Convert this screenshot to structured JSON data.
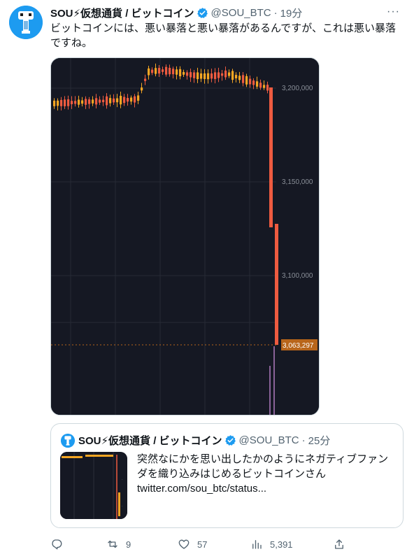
{
  "tweet": {
    "display_name": "SOU⚡仮想通貨 / ビットコイン",
    "handle": "@SOU_BTC",
    "separator": "·",
    "time": "19分",
    "more_label": "···",
    "text_line1": "ビットコインには、悪い暴落と悪い暴落があるんですが、これは悪い暴落",
    "text_line2": "ですね。"
  },
  "chart": {
    "price_labels": [
      "3,200,000",
      "3,150,000",
      "3,100,000"
    ],
    "current_price": "3,063,297",
    "colors": {
      "background": "#151823",
      "up": "#f5a623",
      "down": "#ee5b40",
      "label_bg": "#b8651a"
    }
  },
  "quote": {
    "display_name": "SOU⚡仮想通貨 / ビットコイン",
    "handle": "@SOU_BTC",
    "separator": "·",
    "time": "25分",
    "text_line1": "突然なにかを思い出したかのようにネガティブファン",
    "text_line2": "ダを織り込みはじめるビットコインさん",
    "link": "twitter.com/sou_btc/status..."
  },
  "actions": {
    "reply_count": "",
    "retweet_count": "9",
    "like_count": "57",
    "views_count": "5,391"
  },
  "icons": [
    "reply-icon",
    "retweet-icon",
    "like-icon",
    "views-icon",
    "share-icon",
    "verified-icon"
  ]
}
